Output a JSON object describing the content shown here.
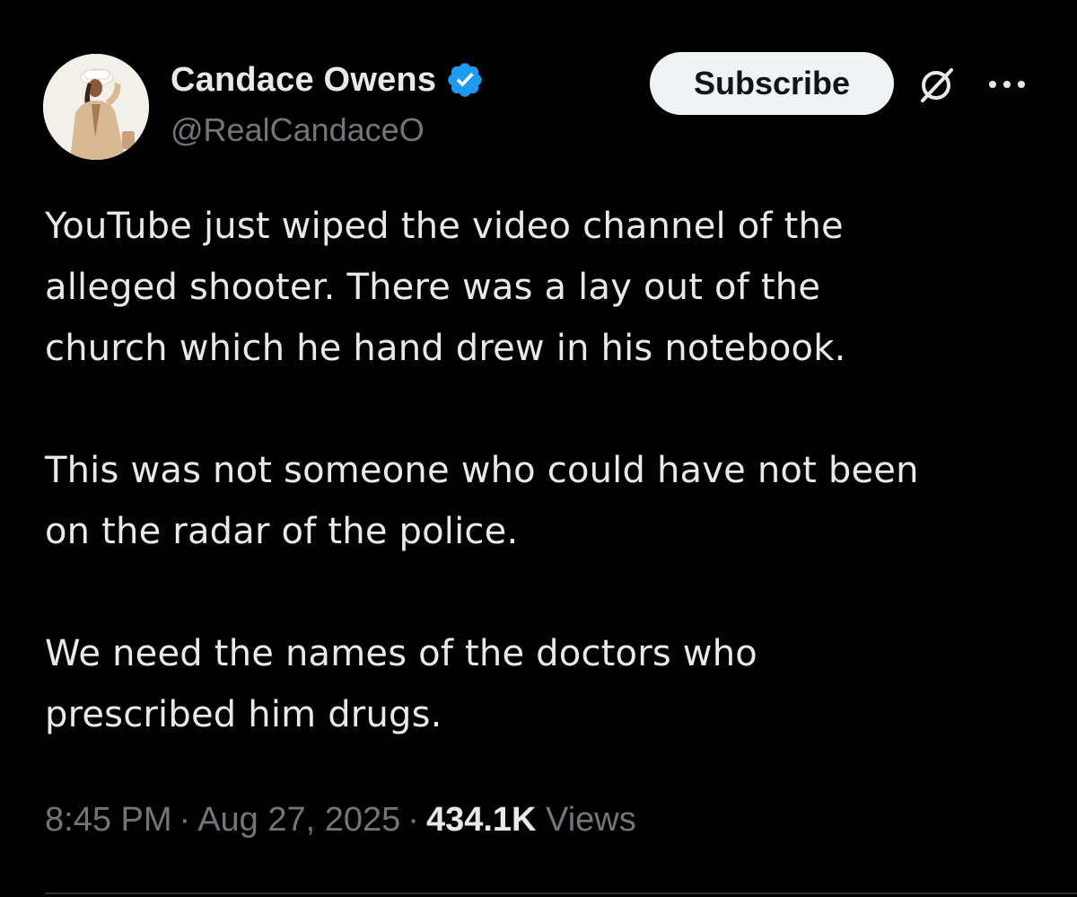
{
  "tweet": {
    "author": {
      "display_name": "Candace Owens",
      "handle": "@RealCandaceO",
      "verified": true
    },
    "subscribe_label": "Subscribe",
    "paragraphs": [
      "YouTube just wiped the video channel of the\nalleged shooter. There was a lay out of the\nchurch which he hand drew in his notebook.",
      "This was not someone who could have not been\non the radar of the police.",
      "We need the names of the doctors who\nprescribed him drugs."
    ],
    "meta": {
      "time": "8:45 PM",
      "separator": "·",
      "date": "Aug 27, 2025",
      "views_count": "434.1K",
      "views_label": "Views"
    }
  },
  "colors": {
    "background": "#000000",
    "text_primary": "#e7e9ea",
    "text_secondary": "#71767b",
    "verified_blue": "#1d9bf0",
    "subscribe_bg": "#eff3f4",
    "subscribe_text": "#0f1419"
  },
  "icons": {
    "verified": "verified-badge-icon",
    "grok": "grok-icon",
    "more": "more-options-icon"
  }
}
